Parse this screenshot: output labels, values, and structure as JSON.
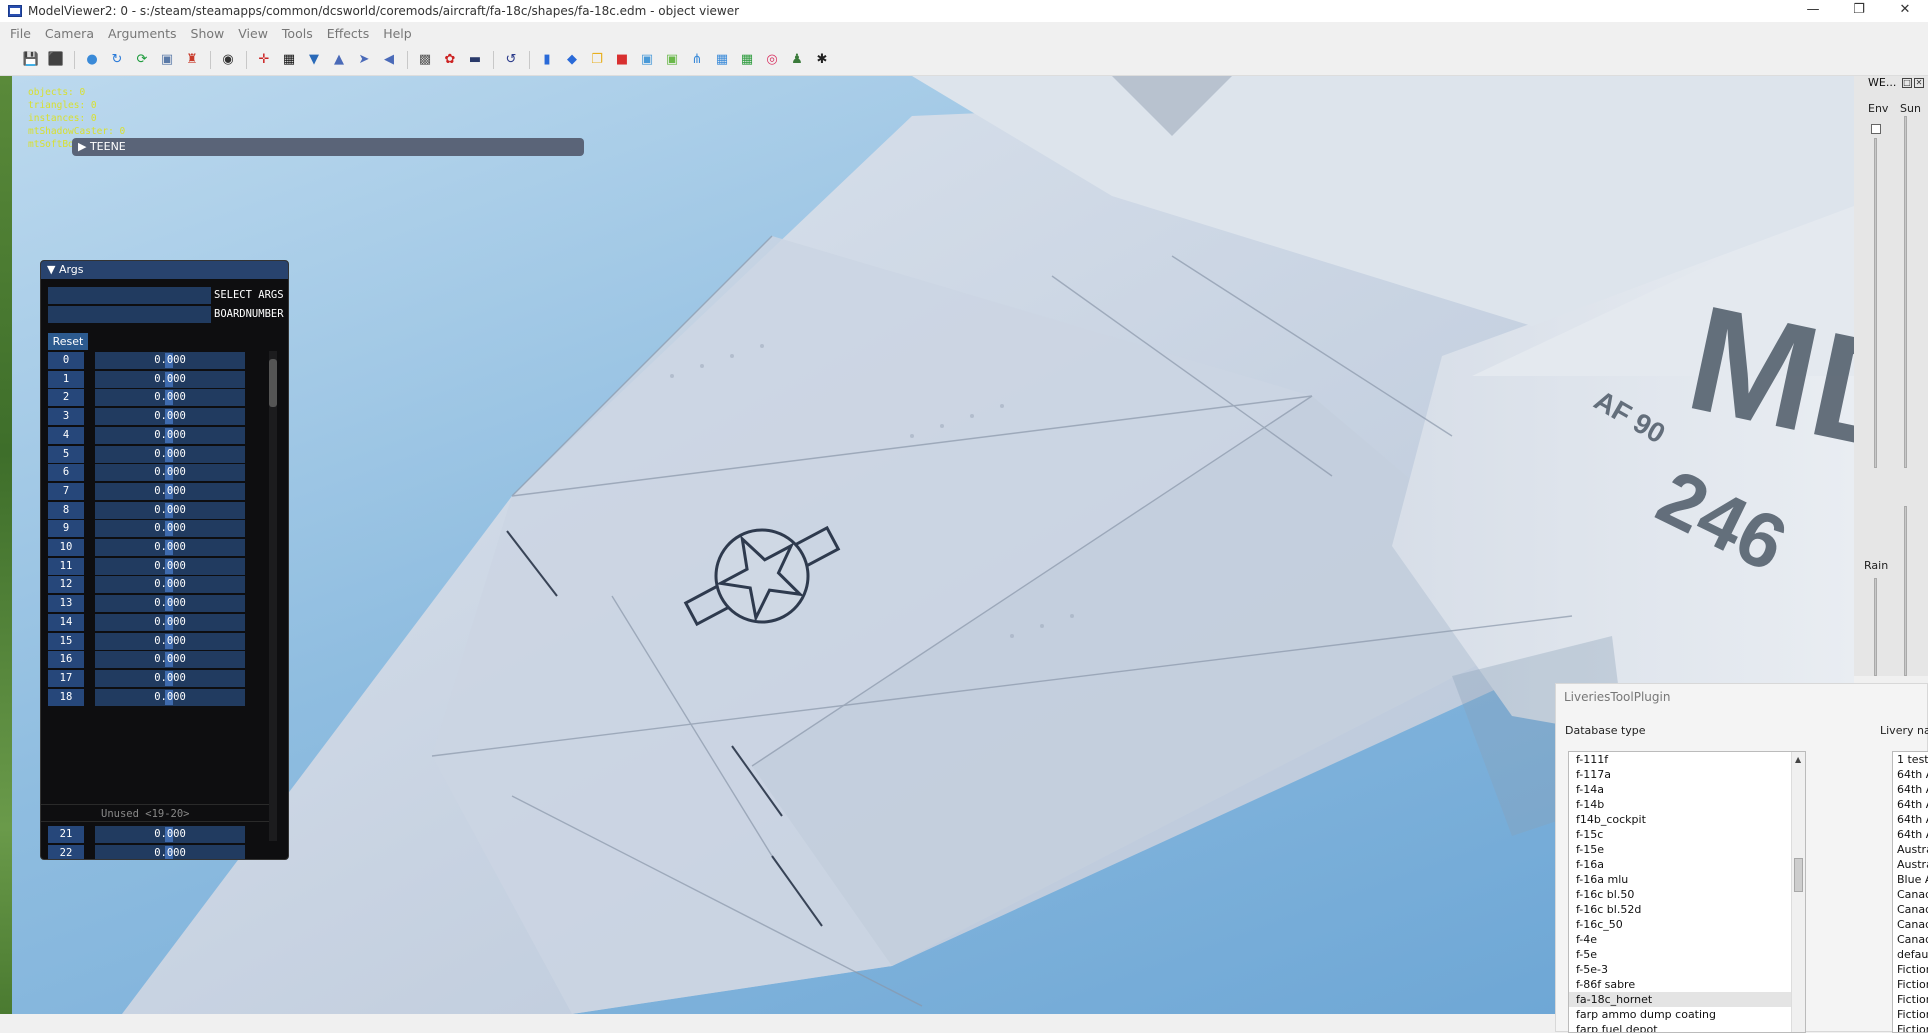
{
  "window": {
    "title": "ModelViewer2: 0 - s:/steam/steamapps/common/dcsworld/coremods/aircraft/fa-18c/shapes/fa-18c.edm - object viewer",
    "minimize": "—",
    "maximize": "❐",
    "close": "✕"
  },
  "menu": [
    "File",
    "Camera",
    "Arguments",
    "Show",
    "View",
    "Tools",
    "Effects",
    "Help"
  ],
  "toolbar": {
    "groups": [
      [
        {
          "icon": "save-icon",
          "glyph": "💾",
          "color": "#2a5aa8"
        },
        {
          "icon": "export-icon",
          "glyph": "⬛",
          "color": "#335"
        }
      ],
      [
        {
          "icon": "sphere-icon",
          "glyph": "●",
          "color": "#3a8ad8"
        },
        {
          "icon": "reload-icon",
          "glyph": "↻",
          "color": "#2a7ad8"
        },
        {
          "icon": "refresh-green-icon",
          "glyph": "⟳",
          "color": "#1a9a3a"
        },
        {
          "icon": "picture-icon",
          "glyph": "▣",
          "color": "#5a7aa8"
        },
        {
          "icon": "skeleton-icon",
          "glyph": "♜",
          "color": "#c83a2a"
        }
      ],
      [
        {
          "icon": "camera-icon",
          "glyph": "◉",
          "color": "#333"
        }
      ],
      [
        {
          "icon": "crosshair-icon",
          "glyph": "✛",
          "color": "#c22"
        },
        {
          "icon": "grid-black-icon",
          "glyph": "▦",
          "color": "#111"
        },
        {
          "icon": "funnel-icon",
          "glyph": "▼",
          "color": "#2a6ab8"
        },
        {
          "icon": "cone-icon",
          "glyph": "▲",
          "color": "#4a6ab8"
        },
        {
          "icon": "arrow-right-icon",
          "glyph": "➤",
          "color": "#4a6ab8"
        },
        {
          "icon": "speaker-icon",
          "glyph": "◀",
          "color": "#4a6ab8"
        }
      ],
      [
        {
          "icon": "texture-icon",
          "glyph": "▩",
          "color": "#555"
        },
        {
          "icon": "colors-icon",
          "glyph": "✿",
          "color": "#c22"
        },
        {
          "icon": "terminal-icon",
          "glyph": "▬",
          "color": "#2a3a6a"
        }
      ],
      [
        {
          "icon": "undo-icon",
          "glyph": "↺",
          "color": "#2a3a8a"
        }
      ],
      [
        {
          "icon": "bar-chart-icon",
          "glyph": "▮",
          "color": "#2a6ad8"
        },
        {
          "icon": "cube-blue-icon",
          "glyph": "◆",
          "color": "#2a6ad8"
        },
        {
          "icon": "copy-icon",
          "glyph": "❐",
          "color": "#e8b020"
        },
        {
          "icon": "cube-red-icon",
          "glyph": "■",
          "color": "#d83030"
        },
        {
          "icon": "box-blue-icon",
          "glyph": "▣",
          "color": "#4a9ad8"
        },
        {
          "icon": "box-green-icon",
          "glyph": "▣",
          "color": "#6ab84a"
        },
        {
          "icon": "network-icon",
          "glyph": "⋔",
          "color": "#3a8ad8"
        },
        {
          "icon": "grid-blue-icon",
          "glyph": "▦",
          "color": "#3a8ad8"
        },
        {
          "icon": "grid-green-icon",
          "glyph": "▦",
          "color": "#2a9a3a"
        },
        {
          "icon": "target-icon",
          "glyph": "◎",
          "color": "#d83060"
        },
        {
          "icon": "person-icon",
          "glyph": "♟",
          "color": "#3a7a3a"
        },
        {
          "icon": "stickman-icon",
          "glyph": "✱",
          "color": "#222"
        }
      ]
    ]
  },
  "stats": {
    "lines": [
      "objects: 0",
      "triangles: 0",
      "instances: 0",
      "mtShadowCaster: 0",
      "mtSoftBo"
    ]
  },
  "teene": {
    "label": "▶ TEENE"
  },
  "args": {
    "title": "▼ Args",
    "select_label": "SELECT ARGS",
    "board_label": "BOARDNUMBER",
    "reset": "Reset",
    "rows": [
      {
        "idx": "0",
        "val": "0.000"
      },
      {
        "idx": "1",
        "val": "0.000"
      },
      {
        "idx": "2",
        "val": "0.000"
      },
      {
        "idx": "3",
        "val": "0.000"
      },
      {
        "idx": "4",
        "val": "0.000"
      },
      {
        "idx": "5",
        "val": "0.000"
      },
      {
        "idx": "6",
        "val": "0.000"
      },
      {
        "idx": "7",
        "val": "0.000"
      },
      {
        "idx": "8",
        "val": "0.000"
      },
      {
        "idx": "9",
        "val": "0.000"
      },
      {
        "idx": "10",
        "val": "0.000"
      },
      {
        "idx": "11",
        "val": "0.000"
      },
      {
        "idx": "12",
        "val": "0.000"
      },
      {
        "idx": "13",
        "val": "0.000"
      },
      {
        "idx": "14",
        "val": "0.000"
      },
      {
        "idx": "15",
        "val": "0.000"
      },
      {
        "idx": "16",
        "val": "0.000"
      },
      {
        "idx": "17",
        "val": "0.000"
      },
      {
        "idx": "18",
        "val": "0.000"
      }
    ],
    "unused": "Unused <19-20>",
    "after_rows": [
      {
        "idx": "21",
        "val": "0.000"
      },
      {
        "idx": "22",
        "val": "0.000"
      }
    ]
  },
  "weather_panel": {
    "title": "WE...",
    "env_label": "Env",
    "sun_label": "Sun",
    "rain_label": "Rain"
  },
  "liveries": {
    "title": "LiveriesToolPlugin",
    "db_label": "Database type",
    "livery_label": "Livery nam",
    "db_items": [
      "f-111f",
      "f-117a",
      "f-14a",
      "f-14b",
      "f14b_cockpit",
      "f-15c",
      "f-15e",
      "f-16a",
      "f-16a mlu",
      "f-16c bl.50",
      "f-16c bl.52d",
      "f-16c_50",
      "f-4e",
      "f-5e",
      "f-5e-3",
      "f-86f sabre",
      "fa-18c_hornet",
      "farp ammo dump coating",
      "farp fuel depot"
    ],
    "db_selected": "fa-18c_hornet",
    "livery_items": [
      "1 test",
      "64th A",
      "64th A",
      "64th A",
      "64th A",
      "64th A",
      "Austra",
      "Austra",
      "Blue A",
      "Canad",
      "Canad",
      "Canad",
      "Canad",
      "defaul",
      "Fiction",
      "Fiction",
      "Fiction",
      "Fiction",
      "Fiction"
    ]
  },
  "aircraft_markings": {
    "tail_letters": "MD",
    "tail_small": "AF 90",
    "tail_number": "246"
  }
}
